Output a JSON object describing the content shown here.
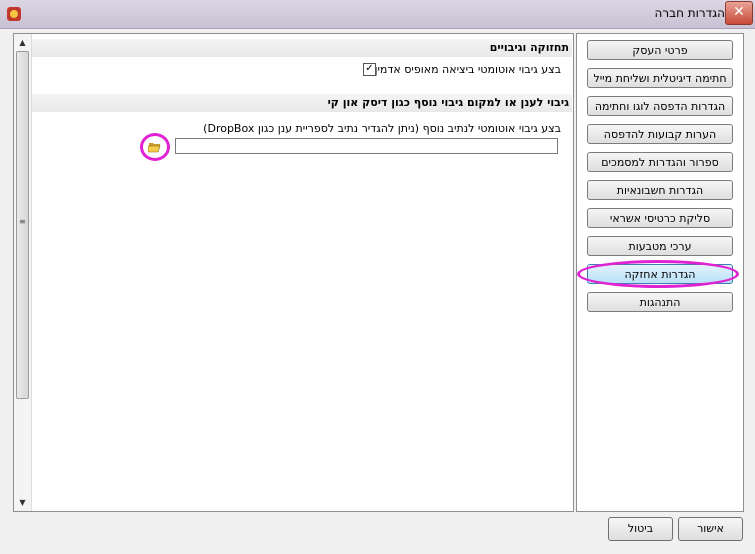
{
  "window": {
    "title": "הגדרות חברה",
    "close_glyph": "✕"
  },
  "sections": {
    "maintenance": {
      "header": "תחזוקה וגיבויים",
      "auto_backup_label": "בצע גיבוי אוטומטי ביציאה מאופיס אדמין",
      "auto_backup_checked": true
    },
    "cloud": {
      "header": "גיבוי לענן או למקום גיבוי נוסף כגון דיסק און קי",
      "extra_path_label": "בצע גיבוי אוטומטי לנתיב נוסף (ניתן להגדיר נתיב לספריית ענן כגון DropBox)",
      "path_value": ""
    }
  },
  "nav": {
    "items": [
      {
        "label": "פרטי העסק"
      },
      {
        "label": "חתימה דיגיטלית ושליחת מייל"
      },
      {
        "label": "הגדרות הדפסה לוגו וחתימה"
      },
      {
        "label": "הערות קבועות להדפסה"
      },
      {
        "label": "ספרור והגדרות למסמכים"
      },
      {
        "label": "הגדרות חשבונאיות"
      },
      {
        "label": "סליקת כרטיסי אשראי"
      },
      {
        "label": "ערכי מטבעות"
      },
      {
        "label": "הגדרות אחזקה"
      },
      {
        "label": "התנהגות"
      }
    ],
    "active_index": 8
  },
  "footer": {
    "ok_label": "אישור",
    "cancel_label": "ביטול"
  },
  "icons": {
    "folder": "open-folder-icon",
    "check": "✓"
  }
}
